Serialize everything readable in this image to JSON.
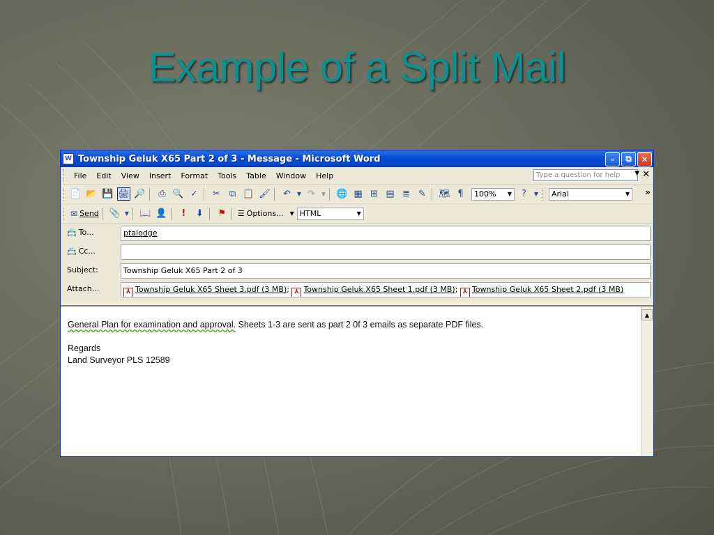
{
  "slide": {
    "title": "Example of a Split Mail"
  },
  "window": {
    "title": "Township Geluk X65 Part 2 of 3 - Message - Microsoft Word",
    "app_icon": "W",
    "minimize_glyph": "–",
    "maximize_glyph": "⧉",
    "close_glyph": "✕"
  },
  "menubar": {
    "items": [
      {
        "label": "File"
      },
      {
        "label": "Edit"
      },
      {
        "label": "View"
      },
      {
        "label": "Insert"
      },
      {
        "label": "Format"
      },
      {
        "label": "Tools"
      },
      {
        "label": "Table"
      },
      {
        "label": "Window"
      },
      {
        "label": "Help"
      }
    ],
    "help_placeholder": "Type a question for help",
    "close_glyph": "✕"
  },
  "toolbar": {
    "zoom": "100%",
    "font": "Arial",
    "icons": [
      "new-icon",
      "open-icon",
      "save-icon",
      "permission-icon",
      "research-icon",
      "print-icon",
      "print-preview-icon",
      "spelling-icon",
      "cut-icon",
      "copy-icon",
      "paste-icon",
      "format-painter-icon",
      "undo-icon",
      "redo-icon",
      "hyperlink-icon",
      "tables-borders-icon",
      "insert-table-icon",
      "insert-excel-icon",
      "columns-icon",
      "drawing-icon",
      "document-map-icon",
      "show-hide-icon",
      "help-icon"
    ]
  },
  "email_toolbar": {
    "send_label": "Send",
    "options_label": "Options...",
    "format": "HTML"
  },
  "fields": {
    "to_label": "To...",
    "to_value": "ptalodge",
    "cc_label": "Cc...",
    "cc_value": "",
    "subject_label": "Subject:",
    "subject_value": "Township Geluk X65 Part 2 of 3",
    "attach_label": "Attach...",
    "attachments": [
      {
        "name": "Township Geluk X65  Sheet 3.pdf (3 MB)"
      },
      {
        "name": "Township Geluk X65  Sheet 1.pdf (3 MB)"
      },
      {
        "name": "Township Geluk X65  Sheet 2.pdf (3 MB)"
      }
    ]
  },
  "body": {
    "line1_part1": "General Plan for examination and approval.",
    "line1_part2": " Sheets 1-3 are sent as part 2 0f 3 emails as separate PDF files.",
    "line2": "Regards",
    "line3": "Land Surveyor PLS 12589"
  },
  "colors": {
    "title_color": "#0f8f8e",
    "titlebar_blue": "#0a4fd6",
    "window_chrome": "#ece9d8"
  }
}
